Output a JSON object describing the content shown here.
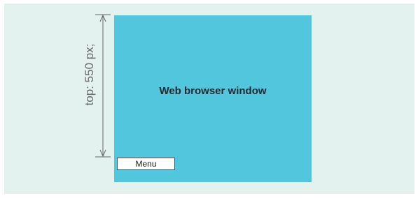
{
  "diagram": {
    "browser_label": "Web browser window",
    "menu_label": "Menu",
    "dimension_label": "top: 550 px;"
  },
  "colors": {
    "background": "#e3f2ee",
    "browser": "#51c6dd",
    "dimension_line": "#666666"
  }
}
